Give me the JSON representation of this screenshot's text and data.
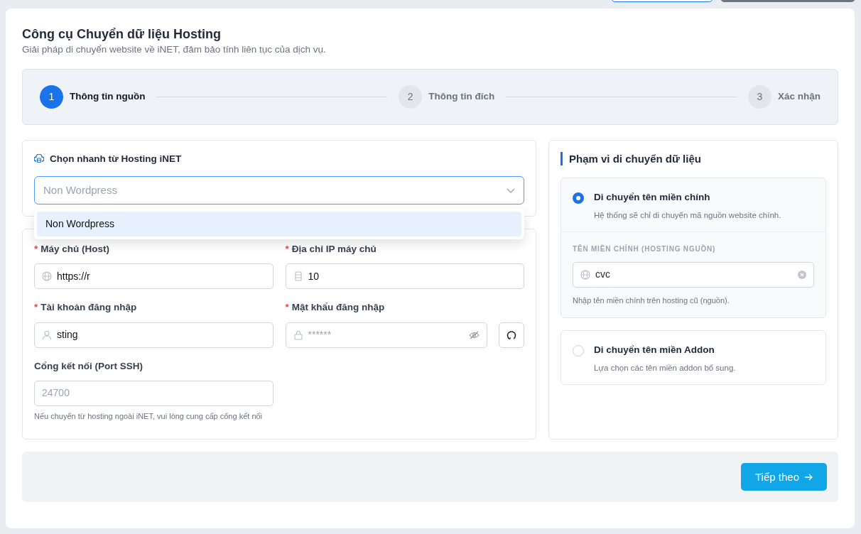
{
  "header": {
    "title": "Công cụ Chuyển dữ liệu Hosting",
    "subtitle": "Giải pháp di chuyển website về iNET, đảm bảo tính liên tục của dịch vụ."
  },
  "steps": [
    {
      "number": "1",
      "label": "Thông tin nguồn",
      "selected": true
    },
    {
      "number": "2",
      "label": "Thông tin đích",
      "selected": false
    },
    {
      "number": "3",
      "label": "Xác nhận",
      "selected": false
    }
  ],
  "quick_select": {
    "title": "Chọn nhanh từ Hosting iNET",
    "placeholder": "Non Wordpress",
    "expanded": true,
    "options": [
      {
        "label": "Non Wordpress",
        "selected": true
      }
    ]
  },
  "fields": [
    {
      "required_mark": "*",
      "label": "Máy chủ (Host)",
      "value": "https://r"
    },
    {
      "required_mark": "*",
      "label": "Địa chỉ IP máy chủ",
      "value": "10"
    },
    {
      "required_mark": "*",
      "label": "Tài khoản đăng nhập",
      "value": "sting"
    },
    {
      "required_mark": "*",
      "label": "Mật khẩu đăng nhập",
      "placeholder": "******",
      "kind": "password"
    },
    {
      "label": "Cổng kết nối (Port SSH)",
      "placeholder": "24700",
      "hint": "Nếu chuyển từ hosting ngoài iNET, vui lòng cung cấp cổng kết nối"
    }
  ],
  "scope": {
    "title": "Phạm vi di chuyển dữ liệu",
    "options": [
      {
        "title": "Di chuyển tên miền chính",
        "description": "Hệ thống sẽ chỉ di chuyển mã nguồn website chính.",
        "selected": true,
        "domain": {
          "label": "TÊN MIỀN CHÍNH (HOSTING NGUỒN)",
          "value": "cvc",
          "hint": "Nhập tên miền chính trên hosting cũ (nguồn)."
        }
      },
      {
        "title": "Di chuyển tên miền Addon",
        "description": "Lựa chọn các tên miền addon bổ sung.",
        "selected": false
      }
    ]
  },
  "footer": {
    "next_button": "Tiếp theo"
  }
}
